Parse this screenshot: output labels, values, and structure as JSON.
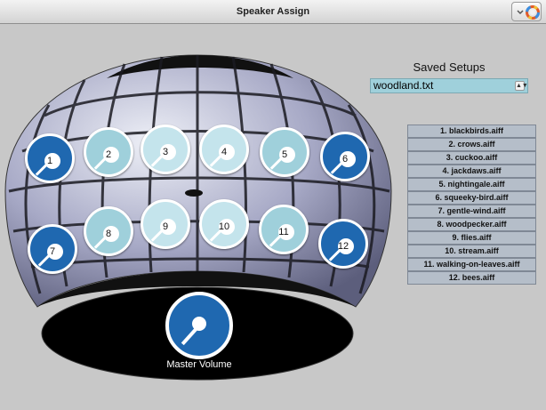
{
  "window": {
    "title": "Speaker Assign"
  },
  "toolbar": {
    "settings_icon": "color-wheel-gear-icon"
  },
  "speakers": [
    {
      "id": "1",
      "tone": "dark"
    },
    {
      "id": "2",
      "tone": "mid"
    },
    {
      "id": "3",
      "tone": "light"
    },
    {
      "id": "4",
      "tone": "light"
    },
    {
      "id": "5",
      "tone": "mid"
    },
    {
      "id": "6",
      "tone": "dark"
    },
    {
      "id": "7",
      "tone": "dark"
    },
    {
      "id": "8",
      "tone": "mid"
    },
    {
      "id": "9",
      "tone": "light"
    },
    {
      "id": "10",
      "tone": "light"
    },
    {
      "id": "11",
      "tone": "mid"
    },
    {
      "id": "12",
      "tone": "dark"
    }
  ],
  "master": {
    "label": "Master Volume"
  },
  "saved_setups": {
    "title": "Saved Setups",
    "selected": "woodland.txt"
  },
  "files": [
    "1. blackbirds.aiff",
    "2. crows.aiff",
    "3. cuckoo.aiff",
    "4. jackdaws.aiff",
    "5. nightingale.aiff",
    "6. squeeky-bird.aiff",
    "7. gentle-wind.aiff",
    "8. woodpecker.aiff",
    "9. flies.aiff",
    "10. stream.aiff",
    "11. walking-on-leaves.aiff",
    "12. bees.aiff"
  ],
  "colors": {
    "knob_dark": "#1f68b0",
    "knob_mid": "#9fd0db",
    "knob_light": "#c4e4ec",
    "file_bg": "#b5bec9"
  }
}
